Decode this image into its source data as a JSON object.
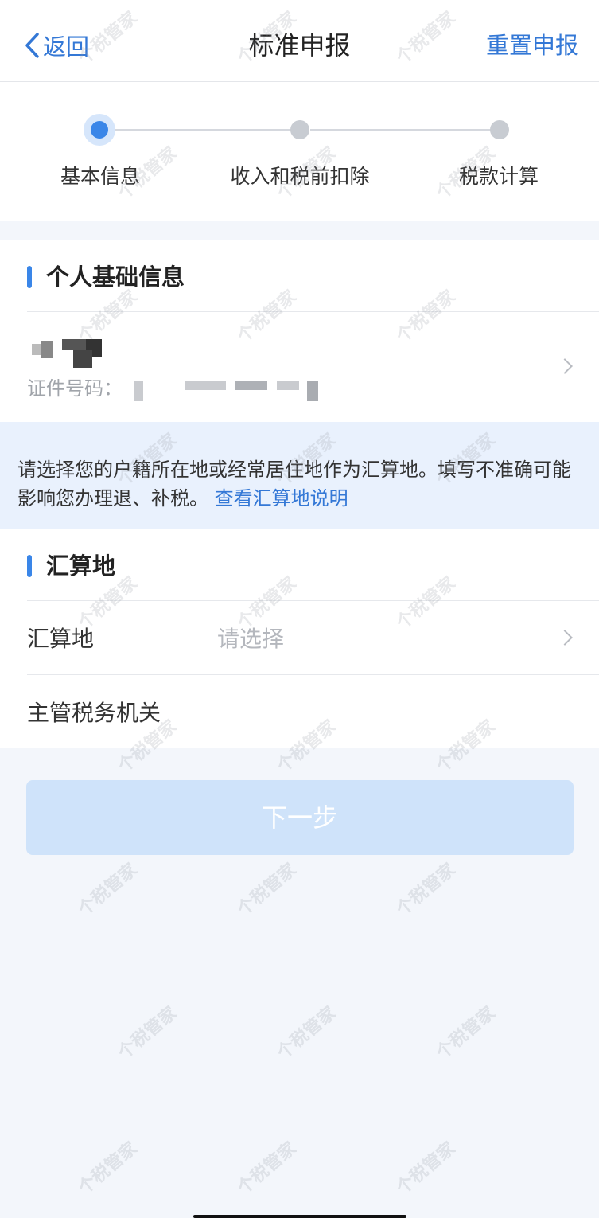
{
  "nav": {
    "back_label": "返回",
    "title": "标准申报",
    "reset_label": "重置申报"
  },
  "steps": {
    "items": [
      {
        "label": "基本信息",
        "state": "active"
      },
      {
        "label": "收入和税前扣除",
        "state": "pending"
      },
      {
        "label": "税款计算",
        "state": "pending"
      }
    ]
  },
  "personal": {
    "section_title": "个人基础信息",
    "id_label": "证件号码："
  },
  "notice": {
    "text": "请选择您的户籍所在地或经常居住地作为汇算地。填写不准确可能影响您办理退、补税。",
    "link_text": "查看汇算地说明"
  },
  "settlement": {
    "section_title": "汇算地",
    "region_label": "汇算地",
    "region_placeholder": "请选择",
    "tax_office_label": "主管税务机关"
  },
  "next_button": "下一步",
  "watermark_text": "个税管家",
  "colors": {
    "accent": "#3478d6",
    "step_active": "#3a86e8",
    "notice_bg": "#e9f1fd",
    "button_disabled": "#cfe3fa",
    "page_bg": "#f3f6fb"
  }
}
